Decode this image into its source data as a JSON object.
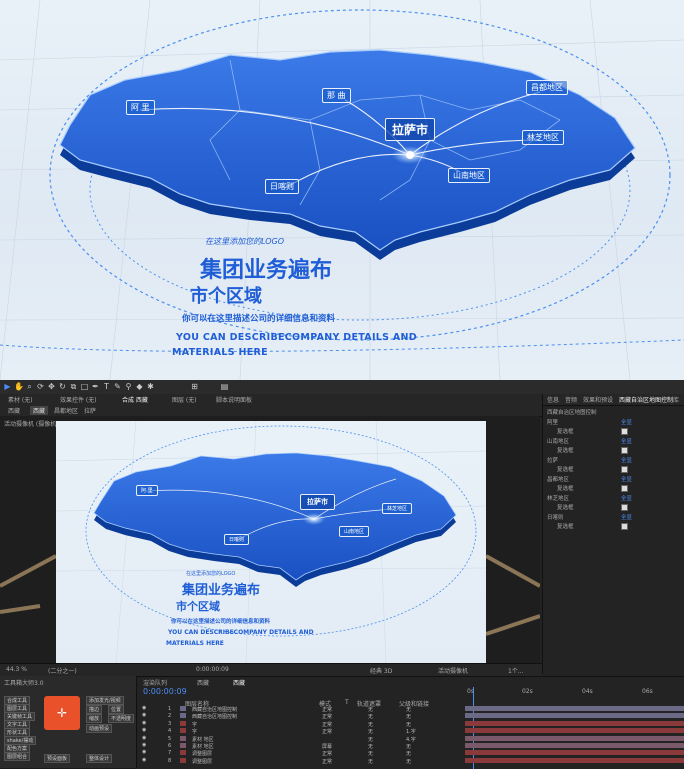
{
  "hero": {
    "map_labels": {
      "ali": "阿 里",
      "naqu": "那 曲",
      "lhasa": "拉萨市",
      "changdu": "昌都地区",
      "linzhi": "林芝地区",
      "shannan": "山南地区",
      "rikaze": "日喀则"
    },
    "logo_text": "在这里添加您的LOGO",
    "title_line1": "集团业务遍布",
    "title_line2": "市个区域",
    "subtitle": "你可以在这里描述公司的详细信息和资料",
    "english_line1": "YOU CAN DESCRIBECOMPANY DETAILS AND",
    "english_line2": "MATERIALS HERE"
  },
  "colors": {
    "map_blue": "#1f5fd6",
    "accent_blue": "#4d8cf5",
    "timeline_red": "#8a3a3a",
    "plugin_orange": "#e8512a"
  },
  "ae": {
    "panel_tabs": [
      "素材 (无)",
      "效果控件 (无)",
      "合成 西藏",
      "图层 (无)",
      "脚本说明面板"
    ],
    "breadcrumbs": [
      "西藏",
      "西藏",
      "昌都地区",
      "拉萨"
    ],
    "viewer_label": "活动摄像机 (摄像机1)",
    "right_panel_tabs": [
      "信息",
      "音频",
      "效果和预设",
      "西藏自治区地图控制",
      "库"
    ],
    "right_panel_title": "西藏自治区地图控制",
    "right_panel_items": [
      {
        "name": "阿里",
        "value": "全显"
      },
      {
        "name": "复选框"
      },
      {
        "name": "山南地区",
        "value": "全显"
      },
      {
        "name": "复选框"
      },
      {
        "name": "拉萨",
        "value": "全显"
      },
      {
        "name": "复选框"
      },
      {
        "name": "昌都地区",
        "value": "全显"
      },
      {
        "name": "复选框"
      },
      {
        "name": "林芝地区",
        "value": "全显"
      },
      {
        "name": "复选框"
      },
      {
        "name": "日喀则",
        "value": "全显"
      },
      {
        "name": "复选框"
      }
    ],
    "viewer_bottom": {
      "zoom": "44.3 %",
      "quality": "(二分之一)",
      "timecode": "0:00:00:09",
      "renderer": "经典 3D",
      "camera": "活动摄像机",
      "views": "1个..."
    },
    "plugin_title": "工具箱大师3.0",
    "plugin_buttons": [
      "合成工具",
      "图层工具",
      "关键帧工具",
      "文字工具",
      "形状工具",
      "添加运动模糊",
      "弹性",
      "模糊发光",
      "预合成",
      "居中",
      "shake/摆动",
      "配色方案",
      "图层组合",
      "预设面板"
    ],
    "plugin_side_buttons": [
      "添加发光/视频",
      "描边",
      "位置",
      "缩放",
      "不透明度",
      "动画预设",
      "整体设计"
    ],
    "timeline": {
      "timecode": "0:00:00:09",
      "tabs": [
        "渲染队列",
        "西藏",
        "西藏"
      ],
      "columns": [
        "图层名称",
        "模式",
        "T",
        "轨道遮罩",
        "父级和链接"
      ],
      "layers": [
        {
          "num": "1",
          "name": "西藏自治区地图控制",
          "mode": "正常",
          "matte": "无",
          "parent": "无"
        },
        {
          "num": "2",
          "name": "西藏自治区地图控制",
          "mode": "正常",
          "matte": "无",
          "parent": "无"
        },
        {
          "num": "3",
          "name": "字",
          "mode": "正常",
          "matte": "无",
          "parent": "无"
        },
        {
          "num": "4",
          "name": "字",
          "mode": "正常",
          "matte": "无",
          "parent": "1.字"
        },
        {
          "num": "5",
          "name": "素材 地区",
          "mode": "",
          "matte": "无",
          "parent": "4.字"
        },
        {
          "num": "6",
          "name": "素材 地区",
          "mode": "屏幕",
          "matte": "无",
          "parent": "无"
        },
        {
          "num": "7",
          "name": "调整图层",
          "mode": "正常",
          "matte": "无",
          "parent": "无"
        },
        {
          "num": "8",
          "name": "调整图层",
          "mode": "正常",
          "matte": "无",
          "parent": "无"
        }
      ],
      "ruler": [
        "0s",
        "02s",
        "04s",
        "06s"
      ]
    }
  }
}
